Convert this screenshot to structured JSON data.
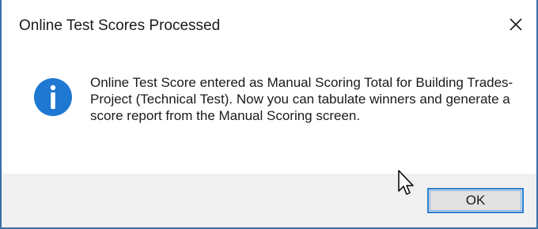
{
  "dialog": {
    "title": "Online Test Scores Processed",
    "close_icon": "close-icon",
    "icon": "info-icon",
    "message": "Online Test Score entered as Manual Scoring Total for Building Trades-Project (Technical Test). Now you can tabulate winners and generate a score report from the Manual Scoring screen.",
    "ok_label": "OK"
  },
  "colors": {
    "info_icon": "#1f78d1",
    "button_focus": "#2a7fd4",
    "footer_bg": "#f0f0f0"
  }
}
